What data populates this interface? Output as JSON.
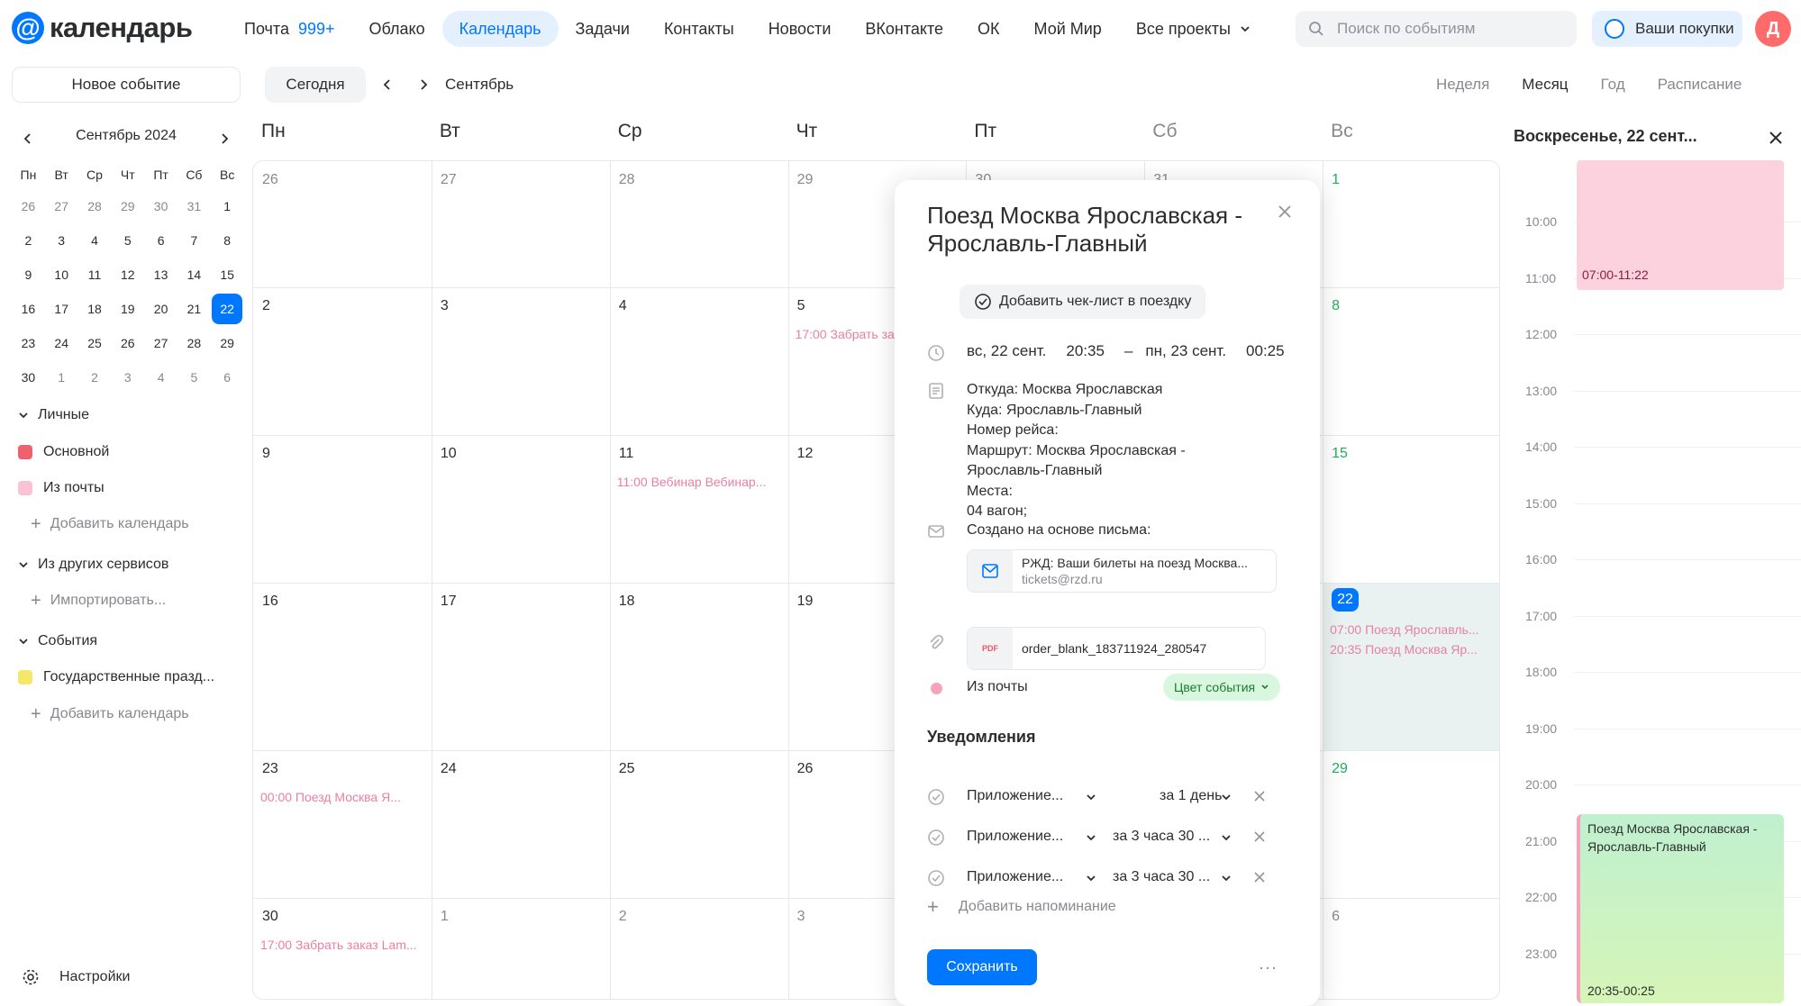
{
  "logo": {
    "text": "календарь"
  },
  "nav": [
    {
      "label": "Почта",
      "badge": "999+"
    },
    {
      "label": "Облако"
    },
    {
      "label": "Календарь",
      "active": true
    },
    {
      "label": "Задачи"
    },
    {
      "label": "Контакты"
    },
    {
      "label": "Новости"
    },
    {
      "label": "ВКонтакте"
    },
    {
      "label": "ОК"
    },
    {
      "label": "Мой Мир"
    },
    {
      "label": "Все проекты"
    }
  ],
  "search": {
    "placeholder": "Поиск по событиям"
  },
  "purchases": {
    "label": "Ваши покупки"
  },
  "avatar": {
    "letter": "Д"
  },
  "toolbar": {
    "new_event": "Новое событие",
    "today": "Сегодня",
    "month": "Сентябрь",
    "views": [
      "Неделя",
      "Месяц",
      "Год",
      "Расписание"
    ],
    "active_view": "Месяц"
  },
  "mini_calendar": {
    "title": "Сентябрь 2024",
    "dow": [
      "Пн",
      "Вт",
      "Ср",
      "Чт",
      "Пт",
      "Сб",
      "Вс"
    ],
    "weeks": [
      [
        "26",
        "27",
        "28",
        "29",
        "30",
        "31",
        "1"
      ],
      [
        "2",
        "3",
        "4",
        "5",
        "6",
        "7",
        "8"
      ],
      [
        "9",
        "10",
        "11",
        "12",
        "13",
        "14",
        "15"
      ],
      [
        "16",
        "17",
        "18",
        "19",
        "20",
        "21",
        "22"
      ],
      [
        "23",
        "24",
        "25",
        "26",
        "27",
        "28",
        "29"
      ],
      [
        "30",
        "1",
        "2",
        "3",
        "4",
        "5",
        "6"
      ]
    ],
    "selected": "22"
  },
  "sidebar": {
    "personal_title": "Личные",
    "personal": [
      {
        "label": "Основной",
        "color": "#f0616f"
      },
      {
        "label": "Из почты",
        "color": "#f9c3d3"
      }
    ],
    "add_calendar": "Добавить календарь",
    "other_title": "Из других сервисов",
    "import": "Импортировать...",
    "events_title": "События",
    "events": [
      {
        "label": "Государственные празд...",
        "color": "#f4e76b"
      }
    ],
    "add_calendar2": "Добавить календарь",
    "settings": "Настройки"
  },
  "month": {
    "dow": [
      "Пн",
      "Вт",
      "Ср",
      "Чт",
      "Пт",
      "Сб",
      "Вс"
    ],
    "weeks": [
      {
        "days": [
          "26",
          "27",
          "28",
          "29",
          "30",
          "31",
          "1"
        ],
        "other": [
          0,
          1,
          2,
          3,
          4,
          5
        ]
      },
      {
        "days": [
          "2",
          "3",
          "4",
          "5",
          "6",
          "7",
          "8"
        ],
        "other": []
      },
      {
        "days": [
          "9",
          "10",
          "11",
          "12",
          "13",
          "14",
          "15"
        ],
        "other": []
      },
      {
        "days": [
          "16",
          "17",
          "18",
          "19",
          "20",
          "21",
          "22"
        ],
        "other": []
      },
      {
        "days": [
          "23",
          "24",
          "25",
          "26",
          "27",
          "28",
          "29"
        ],
        "other": []
      },
      {
        "days": [
          "30",
          "1",
          "2",
          "3",
          "4",
          "5",
          "6"
        ],
        "other": [
          1,
          2,
          3,
          4,
          5,
          6
        ]
      }
    ],
    "events": [
      {
        "week": 1,
        "day": 3,
        "text": "17:00 Забрать за"
      },
      {
        "week": 2,
        "day": 2,
        "text": "11:00 Вебинар Вебинар..."
      },
      {
        "week": 3,
        "day": 6,
        "text": "07:00 Поезд Ярославль..."
      },
      {
        "week": 3,
        "day": 6,
        "text": "20:35 Поезд Москва Яр..."
      },
      {
        "week": 4,
        "day": 0,
        "text": "00:00 Поезд Москва Я..."
      },
      {
        "week": 5,
        "day": 0,
        "text": "17:00 Забрать заказ Lam..."
      }
    ]
  },
  "day_panel": {
    "title": "Воскресенье, 22 сент...",
    "hours": [
      "10:00",
      "11:00",
      "12:00",
      "13:00",
      "14:00",
      "15:00",
      "16:00",
      "17:00",
      "18:00",
      "19:00",
      "20:00",
      "21:00",
      "22:00",
      "23:00"
    ],
    "block1_time": "07:00-11:22",
    "block2_title": "Поезд Москва Ярославская - Ярославль-Главный",
    "block2_time": "20:35-00:25"
  },
  "popup": {
    "title": "Поезд Москва Ярославская - Ярославль-Главный",
    "checklist": "Добавить чек-лист в поездку",
    "start_date": "вс, 22 сент.",
    "start_time": "20:35",
    "dash": "–",
    "end_date": "пн, 23 сент.",
    "end_time": "00:25",
    "description": [
      "Откуда: Москва Ярославская",
      "Куда: Ярославль-Главный",
      "Номер рейса:",
      "Маршрут: Москва Ярославская -",
      "Ярославль-Главный",
      "Места:",
      "04 вагон;"
    ],
    "created_from": "Создано на основе письма:",
    "mail_subject": "РЖД: Ваши билеты на поезд Москва...",
    "mail_from": "tickets@rzd.ru",
    "pdf_badge": "PDF",
    "attachment": "order_blank_183711924_280547",
    "calendar": "Из почты",
    "color_button": "Цвет события",
    "notifications_title": "Уведомления",
    "notifications": [
      {
        "app": "Приложение...",
        "when": "за 1 день"
      },
      {
        "app": "Приложение...",
        "when": "за 3 часа 30 ..."
      },
      {
        "app": "Приложение...",
        "when": "за 3 часа 30 ..."
      }
    ],
    "add_reminder": "Добавить напоминание",
    "save": "Сохранить",
    "more": "···"
  }
}
